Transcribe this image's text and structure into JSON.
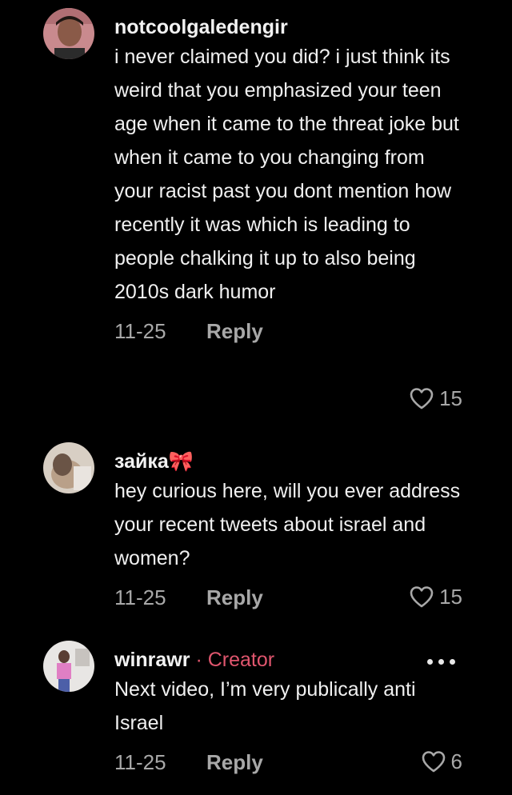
{
  "comments": [
    {
      "username": "notcoolgaledengir",
      "text": "i never claimed you did? i just think its weird that you emphasized your teen age when it came to the threat joke but when it came to you changing from your racist past you dont mention how recently it was which is leading to people chalking it up to also being 2010s dark humor",
      "date": "11-25",
      "reply_label": "Reply",
      "likes": "15"
    },
    {
      "username": "зайка🎀",
      "text": "hey curious here, will you ever address your recent tweets about israel and women?",
      "date": "11-25",
      "reply_label": "Reply",
      "likes": "15"
    },
    {
      "username": "winrawr",
      "separator": "·",
      "badge": "Creator",
      "text": "Next video, I’m very publically anti Israel",
      "date": "11-25",
      "reply_label": "Reply",
      "likes": "6"
    }
  ],
  "icons": {
    "like": "heart-outline-icon",
    "more": "more-horizontal-icon"
  },
  "colors": {
    "background": "#000000",
    "text": "#f0f0f0",
    "muted": "#a8a8a8",
    "creator_badge": "#e0566e"
  }
}
